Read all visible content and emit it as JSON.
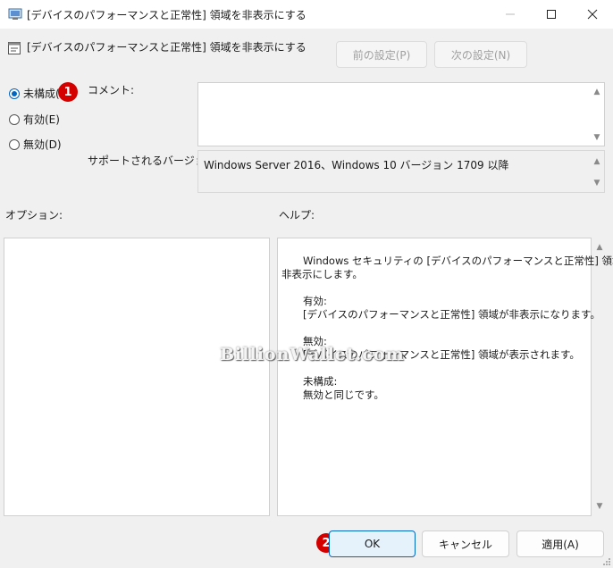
{
  "window": {
    "title": "[デバイスのパフォーマンスと正常性] 領域を非表示にする",
    "minimize_icon": "minimize-icon",
    "maximize_icon": "maximize-icon",
    "close_icon": "close-icon"
  },
  "header": {
    "title": "[デバイスのパフォーマンスと正常性] 領域を非表示にする",
    "prev_button": "前の設定(P)",
    "next_button": "次の設定(N)"
  },
  "state": {
    "options": [
      {
        "label": "未構成(C)",
        "checked": true
      },
      {
        "label": "有効(E)",
        "checked": false
      },
      {
        "label": "無効(D)",
        "checked": false
      }
    ]
  },
  "comment": {
    "label": "コメント:",
    "value": ""
  },
  "supported": {
    "label": "サポートされるバージョン:",
    "value": "Windows Server 2016、Windows 10 バージョン 1709 以降"
  },
  "options_panel": {
    "label": "オプション:"
  },
  "help_panel": {
    "label": "ヘルプ:",
    "lines": [
      "Windows セキュリティの [デバイスのパフォーマンスと正常性] 領域を",
      "非表示にします。",
      "有効:",
      "[デバイスのパフォーマンスと正常性] 領域が非表示になります。",
      "無効:",
      "[デバイスのパフォーマンスと正常性] 領域が表示されます。",
      "未構成:",
      "無効と同じです。"
    ]
  },
  "annotations": {
    "badge1": "1",
    "badge2": "2"
  },
  "watermark": "BillionWallet.com",
  "footer": {
    "ok": "OK",
    "cancel": "キャンセル",
    "apply": "適用(A)"
  },
  "colors": {
    "accent": "#0067c0",
    "badge": "#d40000",
    "window_bg": "#f0f0f0"
  }
}
